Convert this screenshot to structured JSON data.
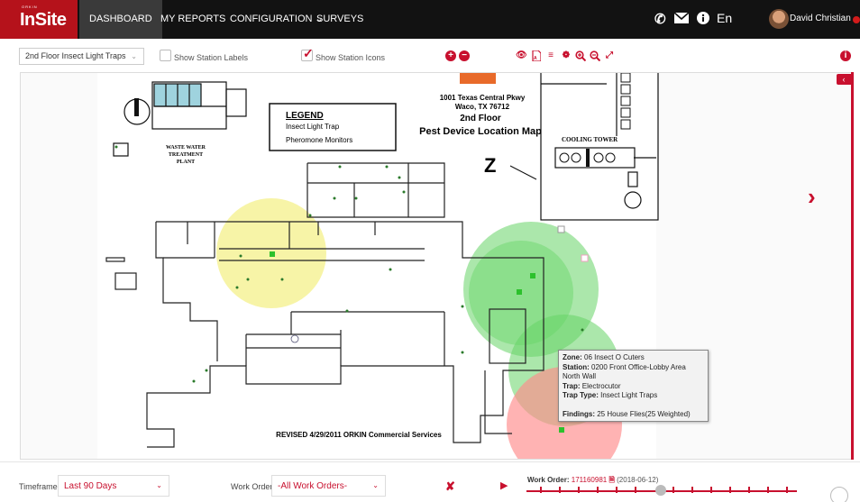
{
  "header": {
    "brand_small": "ORKIN",
    "brand": "InSite",
    "nav": [
      {
        "label": "DASHBOARD"
      },
      {
        "label": "MY REPORTS"
      },
      {
        "label": "CONFIGURATION ⌄"
      },
      {
        "label": "SURVEYS"
      }
    ],
    "language": "En",
    "user_name": "David Christian"
  },
  "toolbar": {
    "floor_select": "2nd Floor Insect Light Traps",
    "show_labels": {
      "label": "Show Station Labels",
      "checked": false
    },
    "show_icons": {
      "label": "Show Station Icons",
      "checked": true
    }
  },
  "map": {
    "address1": "1001 Texas Central Pkwy",
    "address2": "Waco, TX 76712",
    "floor": "2nd Floor",
    "title": "Pest Device Location Map",
    "legend_title": "LEGEND",
    "legend_item1": "Insect Light Trap",
    "legend_item2": "Pheromone Monitors",
    "waste_water": "WASTE WATER",
    "treatment": "TREATMENT",
    "plant": "PLANT",
    "cooling_tower": "COOLING TOWER",
    "north_label": "Z",
    "revised": "REVISED  4/29/2011 ORKIN  Commercial Services"
  },
  "tooltip": {
    "zone_label": "Zone:",
    "zone": "06 Insect O Cuters",
    "station_label": "Station:",
    "station": "0200 Front Office-Lobby Area",
    "station_line2": "North Wall",
    "trap_label": "Trap:",
    "trap": "Electrocutor",
    "trap_type_label": "Trap Type:",
    "trap_type": "Insect Light Traps",
    "findings_label": "Findings:",
    "findings": "25 House Flies(25 Weighted)"
  },
  "bottom": {
    "timeframe_label": "Timeframe",
    "timeframe": "Last 90 Days",
    "workorder_label": "Work Order",
    "workorder": "-All Work Orders-",
    "wo_title": "Work Order:",
    "wo_number": "171160981",
    "wo_date": "(2018-06-12)"
  },
  "colors": {
    "brand": "#b5121b",
    "accent": "#c8102e",
    "heat_yellow": "#f4f08a",
    "heat_green": "#66d466",
    "heat_red": "#ff8a8a"
  }
}
